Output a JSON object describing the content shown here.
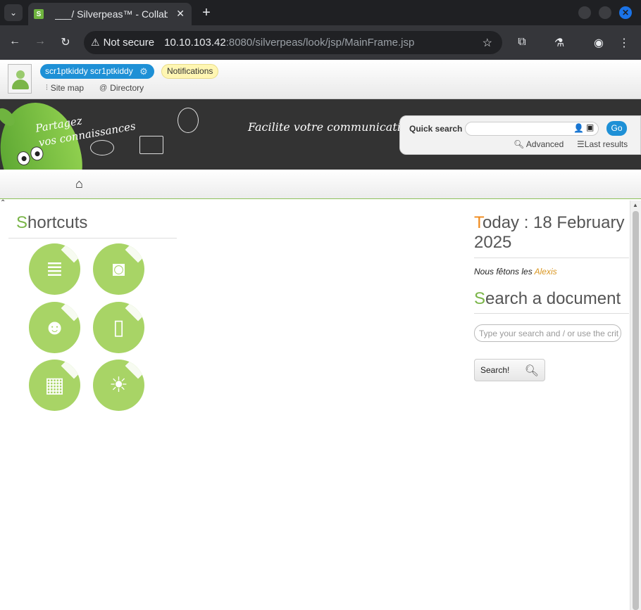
{
  "browser": {
    "tab_title": "___/ Silverpeas™ - Collab",
    "security": "Not secure",
    "url_host": "10.10.103.42",
    "url_path": ":8080/silverpeas/look/jsp/MainFrame.jsp"
  },
  "topbar": {
    "user": "scr1ptkiddy scr1ptkiddy",
    "notifications": "Notifications",
    "sitemap": "Site map",
    "directory": "Directory"
  },
  "banner": {
    "tagline_line1": "Partagez",
    "tagline_line2": "vos connaissances",
    "slogan": "Facilite votre communication"
  },
  "quicksearch": {
    "label": "Quick search",
    "go": "Go",
    "advanced": "Advanced",
    "last_results": "Last results"
  },
  "shortcuts": {
    "title_first": "S",
    "title_rest": "hortcuts",
    "items": [
      "books-icon",
      "camera-icon",
      "people-icon",
      "clipboard-icon",
      "calendar-icon",
      "lightbulb-icon"
    ]
  },
  "today": {
    "title_first": "T",
    "title_rest": "oday : 18 February 2025",
    "feast_prefix": "Nous fêtons les ",
    "feast_name": "Alexis"
  },
  "docsearch": {
    "title_first": "S",
    "title_rest": "earch a document",
    "placeholder": "Type your search and / or use the crit",
    "button": "Search!"
  },
  "colors": {
    "accent_green": "#7ab548",
    "accent_orange": "#f08a1c",
    "button_blue": "#1e90d6"
  }
}
